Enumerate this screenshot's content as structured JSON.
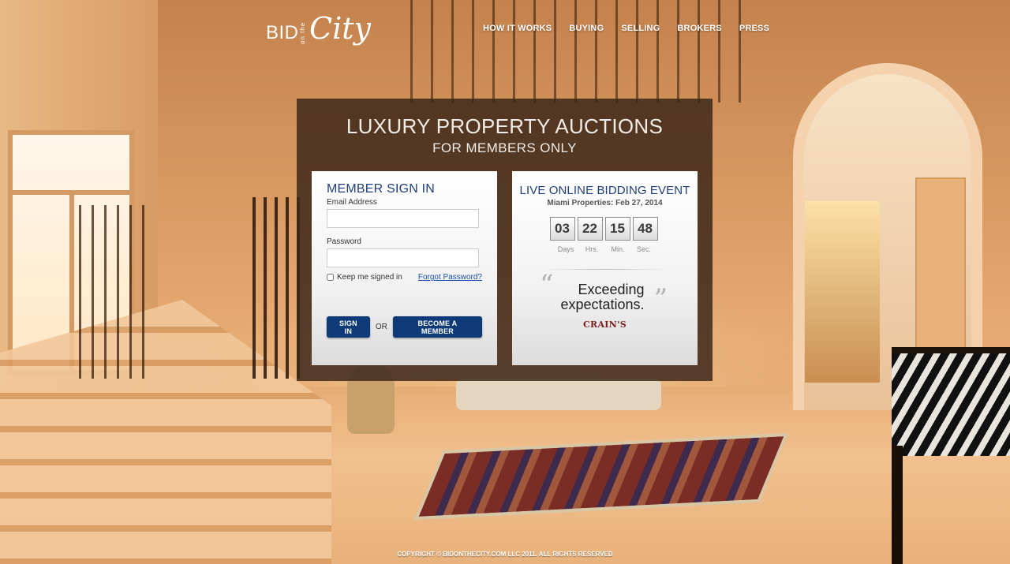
{
  "logo": {
    "bid": "BID",
    "on_the": "on the",
    "city": "City"
  },
  "nav": [
    "HOW IT WORKS",
    "BUYING",
    "SELLING",
    "BROKERS",
    "PRESS"
  ],
  "headline": {
    "line1": "LUXURY PROPERTY AUCTIONS",
    "line2": "FOR MEMBERS ONLY"
  },
  "signin": {
    "title": "MEMBER SIGN IN",
    "email_label": "Email Address",
    "email_value": "",
    "password_label": "Password",
    "password_value": "",
    "keep_signed_in": "Keep me signed in",
    "forgot": "Forgot Password?",
    "signin_button": "SIGN IN",
    "or": "OR",
    "become_member_button": "BECOME A MEMBER"
  },
  "live_event": {
    "title": "LIVE ONLINE BIDDING EVENT",
    "subtitle": "Miami Properties: Feb 27, 2014",
    "countdown": {
      "days": "03",
      "hrs": "22",
      "min": "15",
      "sec": "48"
    },
    "labels": {
      "days": "Days",
      "hrs": "Hrs.",
      "min": "Min.",
      "sec": "Sec."
    },
    "quote_line1": "Exceeding",
    "quote_line2": "expectations.",
    "quote_source": "CRAIN'S"
  },
  "footer": {
    "copyright": "COPYRIGHT © BIDONTHECITY.COM LLC 2011. ALL RIGHTS RESERVED"
  },
  "colors": {
    "brand_blue": "#0e3a78",
    "title_blue": "#1f3f7a",
    "panel": "#3a2619"
  }
}
